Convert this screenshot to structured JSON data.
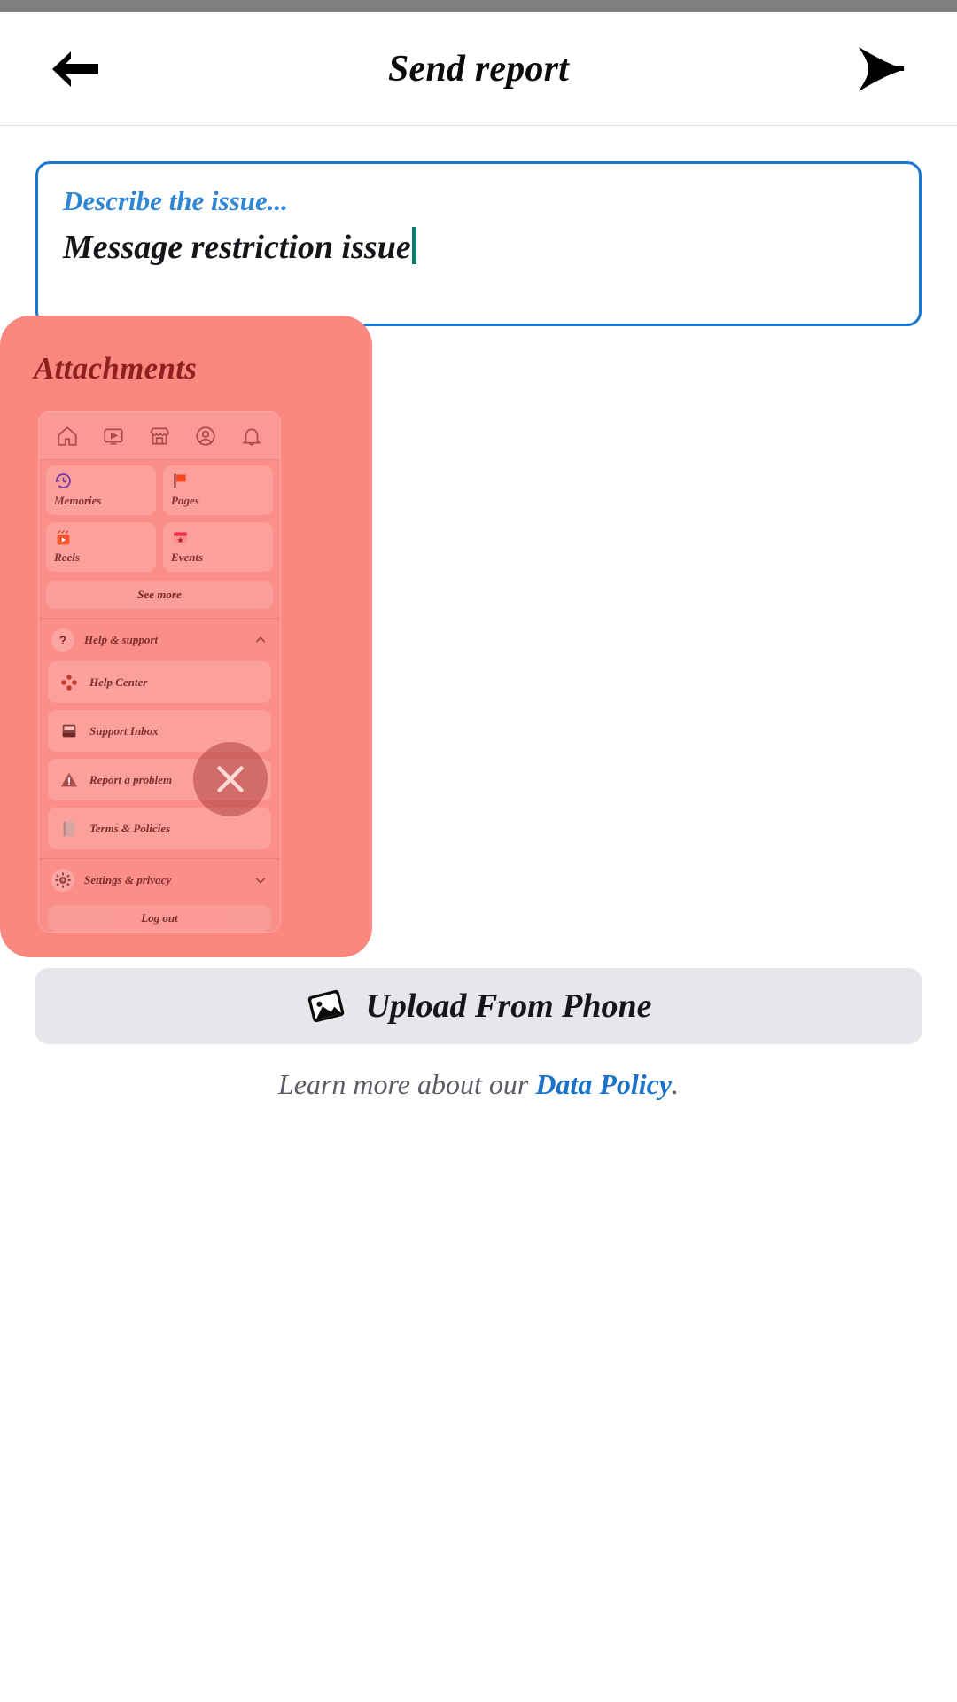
{
  "header": {
    "title": "Send report",
    "back_icon": "arrow-left-icon",
    "send_icon": "send-icon"
  },
  "describe": {
    "label": "Describe the issue...",
    "value": "Message restriction issue",
    "placeholder": "Describe the issue..."
  },
  "attachments": {
    "title": "Attachments",
    "remove_icon": "close-icon",
    "thumbnail": {
      "tabbar": [
        {
          "name": "home-icon"
        },
        {
          "name": "video-icon"
        },
        {
          "name": "marketplace-icon"
        },
        {
          "name": "profile-icon"
        },
        {
          "name": "notifications-icon"
        }
      ],
      "shortcuts": [
        {
          "label": "Memories",
          "icon": "clock-history-icon"
        },
        {
          "label": "Pages",
          "icon": "flag-icon"
        },
        {
          "label": "Reels",
          "icon": "reels-icon"
        },
        {
          "label": "Events",
          "icon": "calendar-star-icon"
        }
      ],
      "see_more": "See more",
      "help_section": {
        "label": "Help & support",
        "icon": "question-circle-icon",
        "chevron": "chevron-up-icon",
        "items": [
          {
            "label": "Help Center",
            "icon": "help-center-icon"
          },
          {
            "label": "Support Inbox",
            "icon": "inbox-icon"
          },
          {
            "label": "Report a problem",
            "icon": "warning-triangle-icon"
          },
          {
            "label": "Terms & Policies",
            "icon": "document-icon"
          }
        ]
      },
      "settings_section": {
        "label": "Settings & privacy",
        "icon": "gear-icon",
        "chevron": "chevron-down-icon"
      },
      "logout": "Log out"
    }
  },
  "upload": {
    "label": "Upload From Phone",
    "icon": "image-icon"
  },
  "footer": {
    "text_before": "Learn more about our ",
    "link": "Data Policy",
    "text_after": "."
  },
  "colors": {
    "accent_blue": "#1877cf",
    "attachment_panel": "#fa8881",
    "attachment_title": "#8e2020",
    "caret": "#0c7a6f",
    "upload_bg": "#e5e7eb",
    "link": "#1a73c8",
    "status_bar": "#7f7f7f"
  }
}
